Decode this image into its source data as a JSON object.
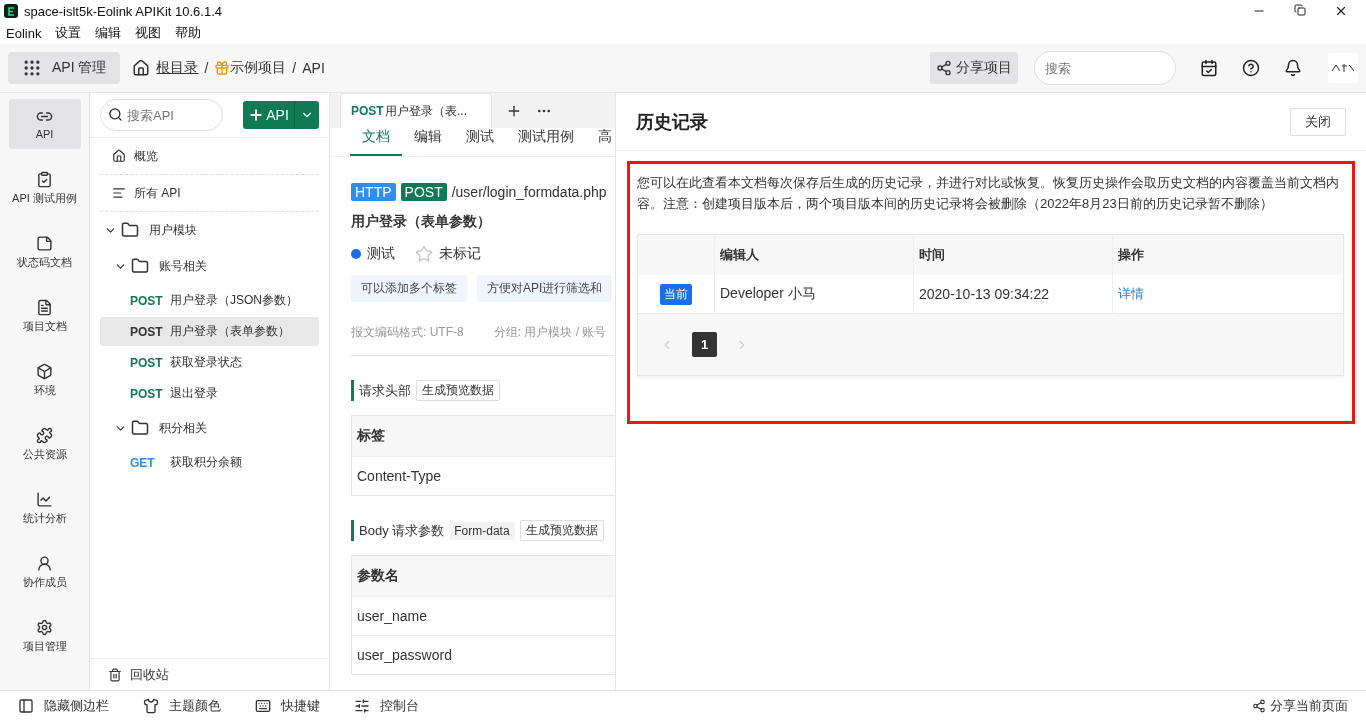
{
  "window": {
    "title": "space-islt5k-Eolink APIKit 10.6.1.4"
  },
  "menu": [
    "Eolink",
    "设置",
    "编辑",
    "视图",
    "帮助"
  ],
  "header": {
    "module": "API 管理",
    "breadcrumb": [
      {
        "kind": "home",
        "text": "根目录"
      },
      {
        "kind": "sep",
        "text": "/"
      },
      {
        "kind": "project",
        "text": "示例项目"
      },
      {
        "kind": "sep",
        "text": "/"
      },
      {
        "kind": "plain",
        "text": "API"
      }
    ],
    "share": "分享项目",
    "search_placeholder": "搜索"
  },
  "nav": [
    {
      "label": "API",
      "selected": true
    },
    {
      "label": "API 测试用例",
      "selected": false
    },
    {
      "label": "状态码文档",
      "selected": false
    },
    {
      "label": "项目文档",
      "selected": false
    },
    {
      "label": "环境",
      "selected": false
    },
    {
      "label": "公共资源",
      "selected": false
    },
    {
      "label": "统计分析",
      "selected": false
    },
    {
      "label": "协作成员",
      "selected": false
    },
    {
      "label": "项目管理",
      "selected": false
    }
  ],
  "tree": {
    "search_placeholder": "搜索API",
    "add_button": "API",
    "items": [
      {
        "kind": "link",
        "label": "概览"
      },
      {
        "kind": "link",
        "label": "所有 API"
      },
      {
        "kind": "folder",
        "label": "用户模块",
        "expanded": true,
        "children": [
          {
            "kind": "folder",
            "label": "账号相关",
            "expanded": true,
            "children": [
              {
                "kind": "api",
                "method": "POST",
                "label": "用户登录（JSON参数）",
                "selected": false
              },
              {
                "kind": "api",
                "method": "POST",
                "label": "用户登录（表单参数）",
                "selected": true
              },
              {
                "kind": "api",
                "method": "POST",
                "label": "获取登录状态",
                "selected": false
              },
              {
                "kind": "api",
                "method": "POST",
                "label": "退出登录",
                "selected": false
              }
            ]
          },
          {
            "kind": "folder",
            "label": "积分相关",
            "expanded": true,
            "children": [
              {
                "kind": "api",
                "method": "GET",
                "label": "获取积分余额",
                "selected": false
              }
            ]
          }
        ]
      }
    ],
    "recycle": "回收站"
  },
  "doc_tab": {
    "method": "POST",
    "title": "用户登录（表..."
  },
  "subtabs": [
    {
      "label": "文档",
      "selected": true
    },
    {
      "label": "编辑",
      "selected": false
    },
    {
      "label": "测试",
      "selected": false
    },
    {
      "label": "测试用例",
      "selected": false
    },
    {
      "label": "高",
      "selected": false
    }
  ],
  "api": {
    "protocol": "HTTP",
    "method": "POST",
    "path": "/user/login_formdata.php",
    "name": "用户登录（表单参数）",
    "status": {
      "label": "测试",
      "color": "#1a6fe8"
    },
    "starred": false,
    "star_label": "未标记",
    "tags": [
      "可以添加多个标签",
      "方便对API进行筛选和"
    ],
    "meta": [
      "报文编码格式: UTF-8",
      "分组: 用户模块 / 账号"
    ],
    "sections": [
      {
        "title": "请求头部",
        "button": "生成预览数据",
        "column": "标签",
        "rows": [
          "Content-Type"
        ]
      },
      {
        "title": "Body 请求参数",
        "badge": "Form-data",
        "button": "生成预览数据",
        "column": "参数名",
        "rows": [
          "user_name",
          "user_password"
        ]
      }
    ]
  },
  "history": {
    "title": "历史记录",
    "close": "关闭",
    "note": "您可以在此查看本文档每次保存后生成的历史记录，并进行对比或恢复。恢复历史操作会取历史文档的内容覆盖当前文档内容。注意：创建项目版本后，两个项目版本间的历史记录将会被删除（2022年8月23日前的历史记录暂不删除）",
    "columns": [
      "编辑人",
      "时间",
      "操作"
    ],
    "rows": [
      {
        "badge": "当前",
        "editor": "Developer 小马",
        "time": "2020-10-13 09:34:22",
        "action": "详情"
      }
    ],
    "pages": [
      {
        "label": "1",
        "selected": true
      }
    ]
  },
  "bottom_bar": {
    "items": [
      {
        "label": "隐藏侧边栏"
      },
      {
        "label": "主题颜色"
      },
      {
        "label": "快捷键"
      },
      {
        "label": "控制台"
      }
    ],
    "share": "分享当前页面"
  }
}
